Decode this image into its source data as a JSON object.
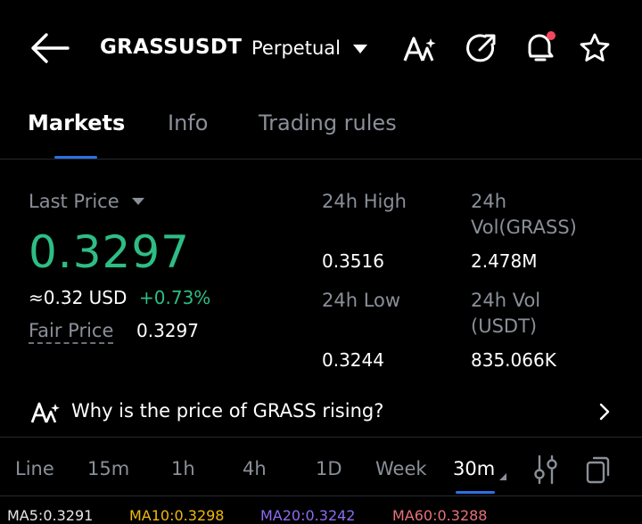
{
  "header": {
    "symbol": "GRASSUSDT",
    "contract_type": "Perpetual"
  },
  "tabs": [
    {
      "label": "Markets",
      "active": true
    },
    {
      "label": "Info",
      "active": false
    },
    {
      "label": "Trading rules",
      "active": false
    }
  ],
  "market": {
    "last_price_label": "Last Price",
    "last_price": "0.3297",
    "usd_approx": "≈0.32 USD",
    "change_pct": "+0.73%",
    "fair_price_label": "Fair Price",
    "fair_price": "0.3297",
    "high_label": "24h High",
    "high_value": "0.3516",
    "vol_grass_label_1": "24h",
    "vol_grass_label_2": "Vol(GRASS)",
    "vol_grass_value": "2.478M",
    "low_label": "24h Low",
    "low_value": "0.3244",
    "vol_usdt_label_1": "24h Vol",
    "vol_usdt_label_2": "(USDT)",
    "vol_usdt_value": "835.066K"
  },
  "insight": {
    "text": "Why is the price of GRASS rising?"
  },
  "timeframes": [
    {
      "label": "Line",
      "active": false
    },
    {
      "label": "15m",
      "active": false
    },
    {
      "label": "1h",
      "active": false
    },
    {
      "label": "4h",
      "active": false
    },
    {
      "label": "1D",
      "active": false
    },
    {
      "label": "Week",
      "active": false
    },
    {
      "label": "30m",
      "active": true
    }
  ],
  "ma_indicators": [
    {
      "label": "MA5:0.3291",
      "color": "#e6e6e6"
    },
    {
      "label": "MA10:0.3298",
      "color": "#f0b90b"
    },
    {
      "label": "MA20:0.3242",
      "color": "#8b6cf0"
    },
    {
      "label": "MA60:0.3288",
      "color": "#e5727a"
    }
  ],
  "icons": [
    "back-arrow-icon",
    "dropdown-caret-icon",
    "ai-icon",
    "share-icon",
    "bell-icon",
    "star-icon",
    "chevron-right-icon",
    "settings-sliders-icon",
    "copy-icon"
  ],
  "colors": {
    "accent": "#2f6fe4",
    "up": "#2ebd85",
    "notification_dot": "#f6465d"
  }
}
